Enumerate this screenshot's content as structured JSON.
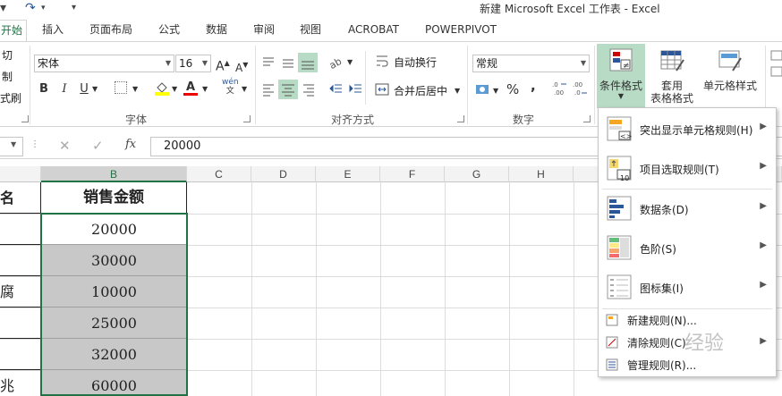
{
  "window": {
    "title": "新建 Microsoft Excel 工作表 - Excel"
  },
  "tabs": [
    {
      "label": "开始",
      "active": true
    },
    {
      "label": "插入"
    },
    {
      "label": "页面布局"
    },
    {
      "label": "公式"
    },
    {
      "label": "数据"
    },
    {
      "label": "审阅"
    },
    {
      "label": "视图"
    },
    {
      "label": "ACROBAT"
    },
    {
      "label": "POWERPIVOT"
    }
  ],
  "clipboard": {
    "cut": "切",
    "copy": "制",
    "format_painter": "式刷"
  },
  "font": {
    "name": "宋体",
    "size": "16",
    "bold": "B",
    "italic": "I",
    "underline": "U",
    "grow": "A",
    "shrink": "A",
    "phonetic": "wén",
    "group_label": "字体"
  },
  "alignment": {
    "wrap_text": "自动换行",
    "merge_center": "合并后居中",
    "group_label": "对齐方式"
  },
  "number": {
    "format": "常规",
    "percent": "%",
    "comma": ",",
    "group_label": "数字"
  },
  "styles": {
    "conditional_formatting": "条件格式",
    "format_as_table_1": "套用",
    "format_as_table_2": "表格格式",
    "cell_styles": "单元格样式"
  },
  "formula_bar": {
    "value": "20000",
    "fx": "fx"
  },
  "columns": [
    "B",
    "C",
    "D",
    "E",
    "F",
    "G",
    "H"
  ],
  "sheet": {
    "header_a": "名",
    "header_b": "销售金额",
    "rows": [
      {
        "a": "",
        "b": "20000"
      },
      {
        "a": "",
        "b": "30000"
      },
      {
        "a": "腐",
        "b": "10000"
      },
      {
        "a": "",
        "b": "25000"
      },
      {
        "a": "",
        "b": "32000"
      },
      {
        "a": "兆",
        "b": "60000"
      }
    ]
  },
  "cf_menu": {
    "items": [
      {
        "label": "突出显示单元格规则(H)"
      },
      {
        "label": "项目选取规则(T)"
      },
      {
        "label": "数据条(D)"
      },
      {
        "label": "色阶(S)"
      },
      {
        "label": "图标集(I)"
      },
      {
        "label": "新建规则(N)..."
      },
      {
        "label": "清除规则(C)"
      },
      {
        "label": "管理规则(R)..."
      }
    ],
    "top10_badge": "10"
  },
  "watermark": "经验",
  "colors": {
    "accent": "#217346",
    "highlight": "#b7dbc4",
    "gray_cell": "#c8c8c8"
  }
}
